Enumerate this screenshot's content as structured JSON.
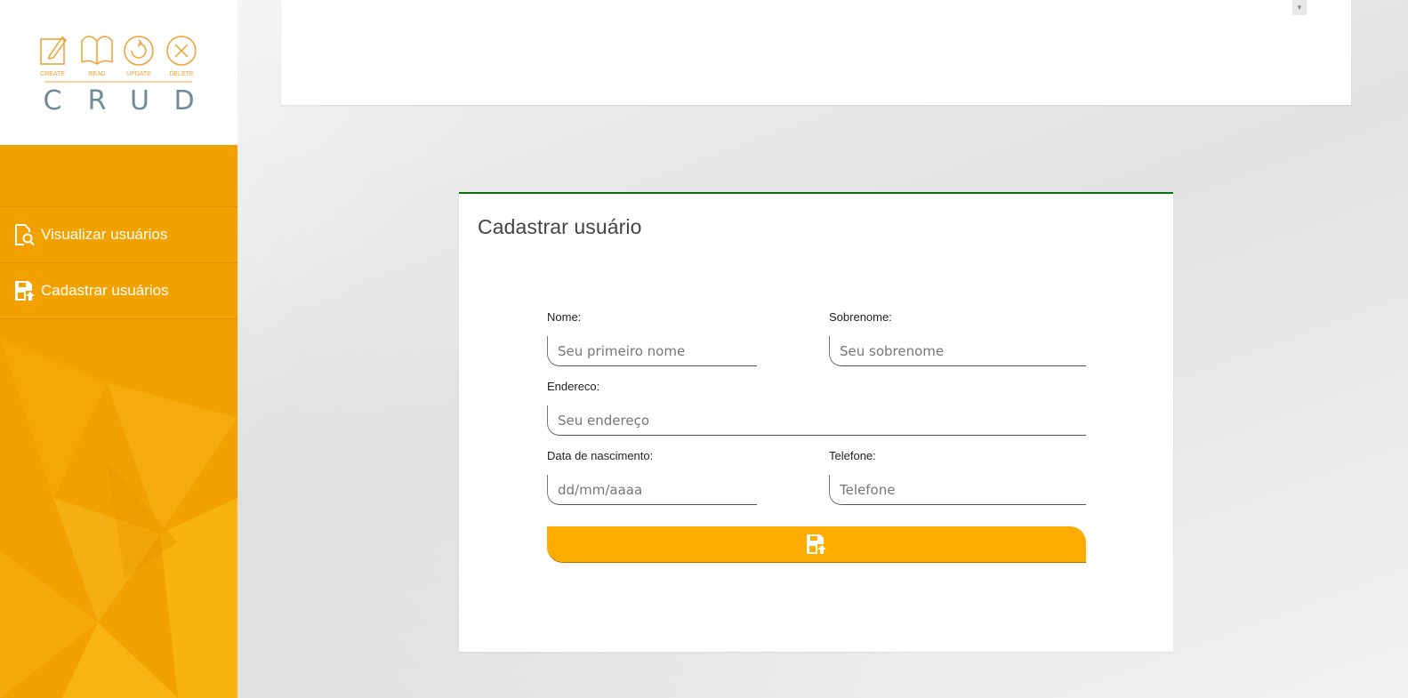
{
  "logo": {
    "letters": [
      "C",
      "R",
      "U",
      "D"
    ],
    "captions": [
      "CREATE",
      "READ",
      "UPDATE",
      "DELETE"
    ],
    "icons": [
      "edit-icon",
      "book-icon",
      "refresh-icon",
      "delete-icon"
    ]
  },
  "sidebar": {
    "items": [
      {
        "label": "Visualizar usuários",
        "icon": "search-document-icon"
      },
      {
        "label": "Cadastrar usuários",
        "icon": "save-icon"
      }
    ]
  },
  "form": {
    "title": "Cadastrar usuário",
    "nome": {
      "label": "Nome:",
      "placeholder": "Seu primeiro nome"
    },
    "sobrenome": {
      "label": "Sobrenome:",
      "placeholder": "Seu sobrenome"
    },
    "endereco": {
      "label": "Endereco:",
      "placeholder": "Seu endereço"
    },
    "nascimento": {
      "label": "Data de nascimento:",
      "placeholder": "dd/mm/aaaa"
    },
    "telefone": {
      "label": "Telefone:",
      "placeholder": "Telefone"
    },
    "submit_icon": "save-icon"
  },
  "colors": {
    "sidebar": "#f2a200",
    "button": "#ffac00",
    "card_accent": "#0a6e0a",
    "logo_orange": "#f0a030",
    "logo_gray": "#6f8c96"
  }
}
